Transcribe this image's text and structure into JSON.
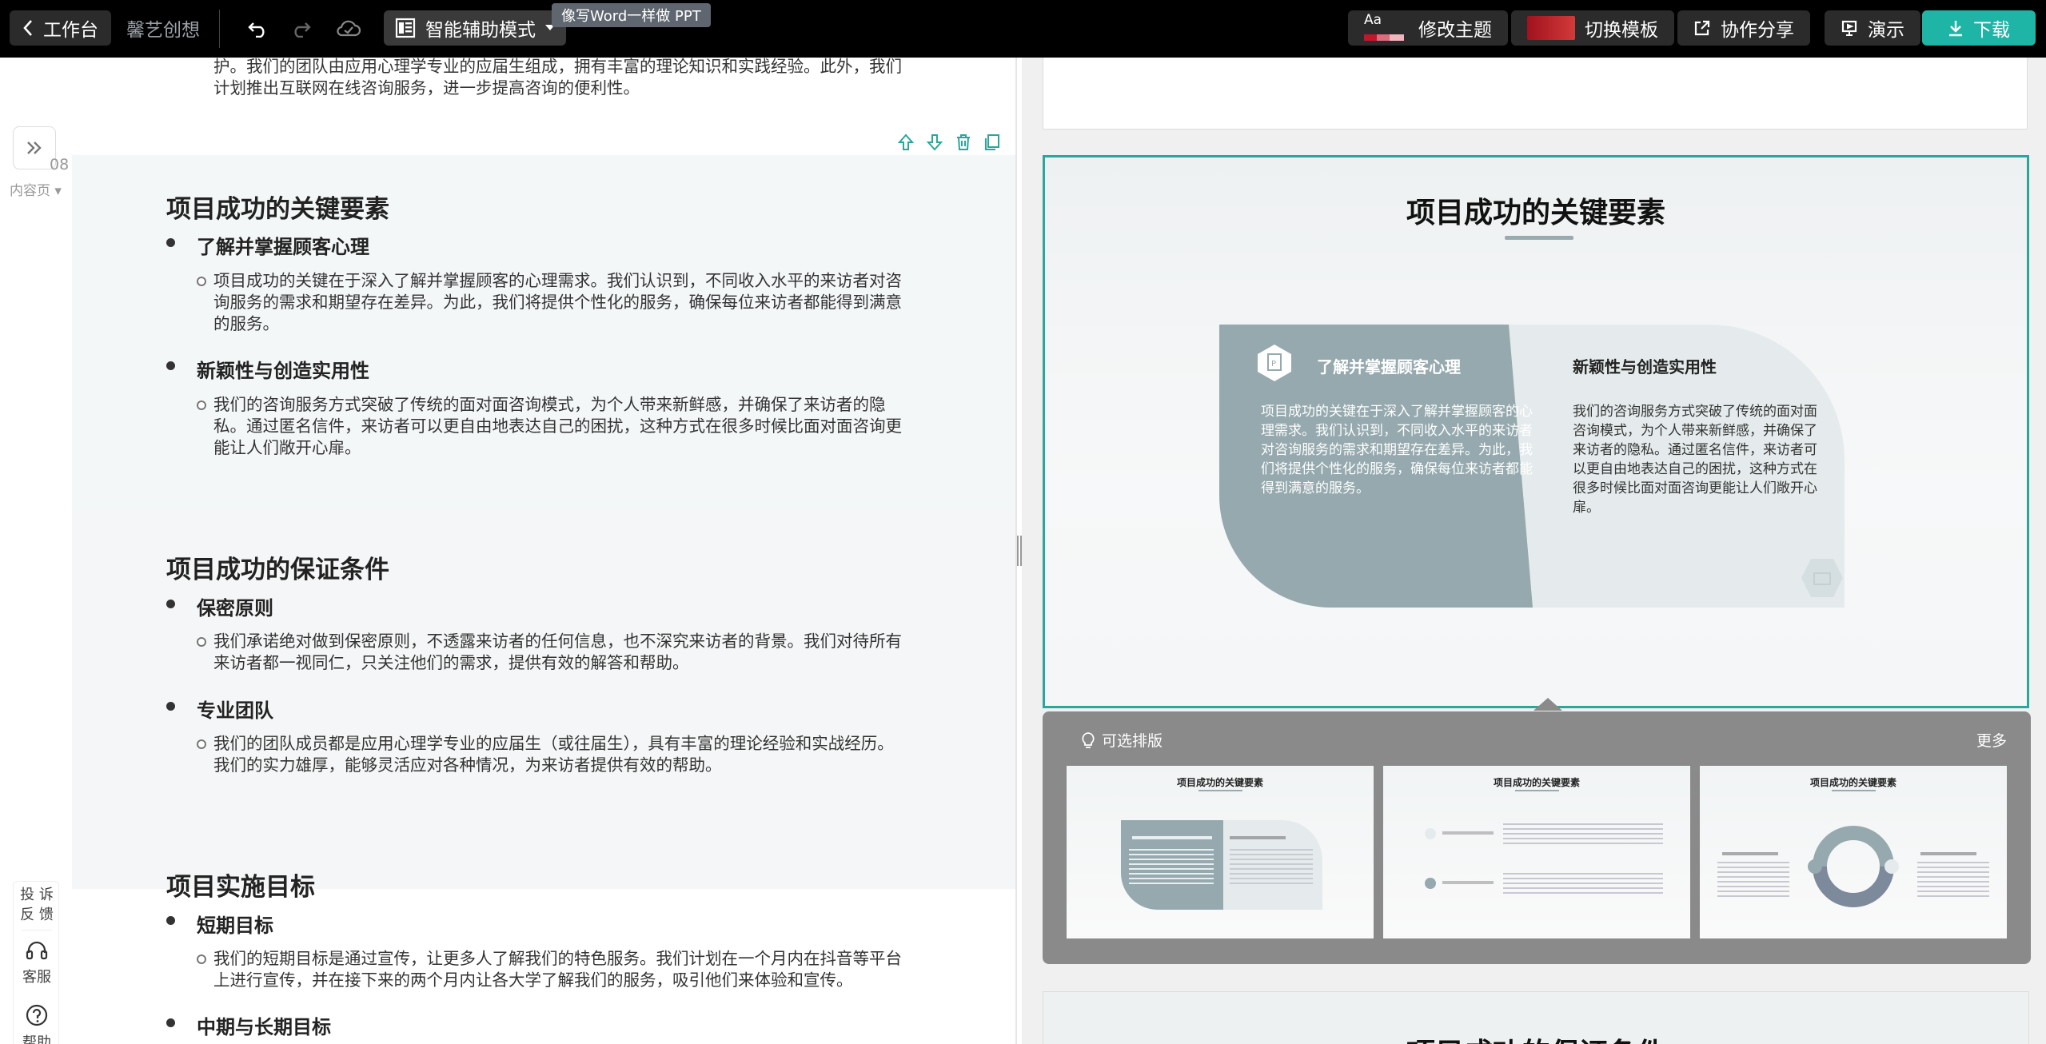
{
  "topbar": {
    "back_label": "工作台",
    "brand": "馨艺创想",
    "mode_label": "智能辅助模式",
    "tooltip": "像写Word一样做 PPT",
    "theme_icon_text": "Aa",
    "theme_label": "修改主题",
    "template_label": "切换模板",
    "share_label": "协作分享",
    "present_label": "演示",
    "download_label": "下载",
    "accent": "#1eb5a6"
  },
  "editor": {
    "top_para": "护。我们的团队由应用心理学专业的应届生组成，拥有丰富的理论知识和实践经验。此外，我们计划推出互联网在线咨询服务，进一步提高咨询的便利性。",
    "page_number": "08",
    "page_type": "内容页",
    "sections": [
      {
        "title": "项目成功的关键要素",
        "items": [
          {
            "heading": "了解并掌握顾客心理",
            "text": "项目成功的关键在于深入了解并掌握顾客的心理需求。我们认识到，不同收入水平的来访者对咨询服务的需求和期望存在差异。为此，我们将提供个性化的服务，确保每位来访者都能得到满意的服务。"
          },
          {
            "heading": "新颖性与创造实用性",
            "text": "我们的咨询服务方式突破了传统的面对面咨询模式，为个人带来新鲜感，并确保了来访者的隐私。通过匿名信件，来访者可以更自由地表达自己的困扰，这种方式在很多时候比面对面咨询更能让人们敞开心扉。"
          }
        ]
      },
      {
        "title": "项目成功的保证条件",
        "items": [
          {
            "heading": "保密原则",
            "text": "我们承诺绝对做到保密原则，不透露来访者的任何信息，也不深究来访者的背景。我们对待所有来访者都一视同仁，只关注他们的需求，提供有效的解答和帮助。"
          },
          {
            "heading": "专业团队",
            "text": "我们的团队成员都是应用心理学专业的应届生（或往届生），具有丰富的理论经验和实战经历。我们的实力雄厚，能够灵活应对各种情况，为来访者提供有效的帮助。"
          }
        ]
      },
      {
        "title": "项目实施目标",
        "items": [
          {
            "heading": "短期目标",
            "text": "我们的短期目标是通过宣传，让更多人了解我们的特色服务。我们计划在一个月内在抖音等平台上进行宣传，并在接下来的两个月内让各大学了解我们的服务，吸引他们来体验和宣传。"
          },
          {
            "heading": "中期与长期目标",
            "text": ""
          }
        ]
      }
    ],
    "side": {
      "complain": "投 诉",
      "feedback": "反 馈",
      "service": "客服",
      "help": "帮助"
    }
  },
  "preview": {
    "slide_title": "项目成功的关键要素",
    "card_left_heading": "了解并掌握顾客心理",
    "card_left_text": "项目成功的关键在于深入了解并掌握顾客的心理需求。我们认识到，不同收入水平的来访者对咨询服务的需求和期望存在差异。为此，我们将提供个性化的服务，确保每位来访者都能得到满意的服务。",
    "card_right_heading": "新颖性与创造实用性",
    "card_right_text": "我们的咨询服务方式突破了传统的面对面咨询模式，为个人带来新鲜感，并确保了来访者的隐私。通过匿名信件，来访者可以更自由地表达自己的困扰，这种方式在很多时候比面对面咨询更能让人们敞开心扉。",
    "card_left_color": "#95a9ae",
    "card_right_color": "#e5ebec",
    "layouts_label": "可选排版",
    "more_label": "更多",
    "thumb_title": "项目成功的关键要素",
    "next_slide_title": "项目成功的保证条件"
  }
}
